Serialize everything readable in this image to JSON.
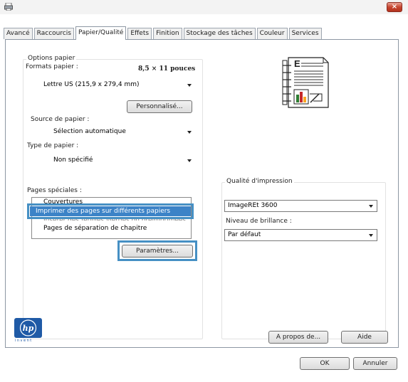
{
  "window": {
    "close_glyph": "×"
  },
  "tabs": [
    {
      "label": "Avancé",
      "active": false
    },
    {
      "label": "Raccourcis",
      "active": false
    },
    {
      "label": "Papier/Qualité",
      "active": true
    },
    {
      "label": "Effets",
      "active": false
    },
    {
      "label": "Finition",
      "active": false
    },
    {
      "label": "Stockage des tâches",
      "active": false
    },
    {
      "label": "Couleur",
      "active": false
    },
    {
      "label": "Services",
      "active": false
    }
  ],
  "paper_options": {
    "legend": "Options papier",
    "formats_label": "Formats papier :",
    "formats_size": "8,5 × 11 pouces",
    "format_value": "Lettre US (215,9 x 279,4 mm)",
    "custom_button": "Personnalisé...",
    "source_label": "Source de papier :",
    "source_value": "Sélection automatique",
    "type_label": "Type de papier :",
    "type_value": "Non spécifié",
    "special_pages_label": "Pages spéciales :",
    "special_pages_items": [
      "Couvertures",
      "Imprimer des pages sur différents papiers",
      "Insérer des feuilles vierges ou préimprimées",
      "Pages de séparation de chapitre"
    ],
    "settings_button": "Paramètres..."
  },
  "print_quality": {
    "legend": "Qualité d'impression",
    "quality_value": "ImageREt 3600",
    "gloss_label": "Niveau de brillance :",
    "gloss_value": "Par défaut"
  },
  "footer": {
    "hp_logo_text": "hp",
    "hp_tagline": "invent",
    "about_button": "A propos de...",
    "help_button": "Aide",
    "ok_button": "OK",
    "cancel_button": "Annuler"
  },
  "colors": {
    "highlight": "#4690c4",
    "selection": "#3c83c7",
    "hp_blue": "#1f5aa6"
  }
}
